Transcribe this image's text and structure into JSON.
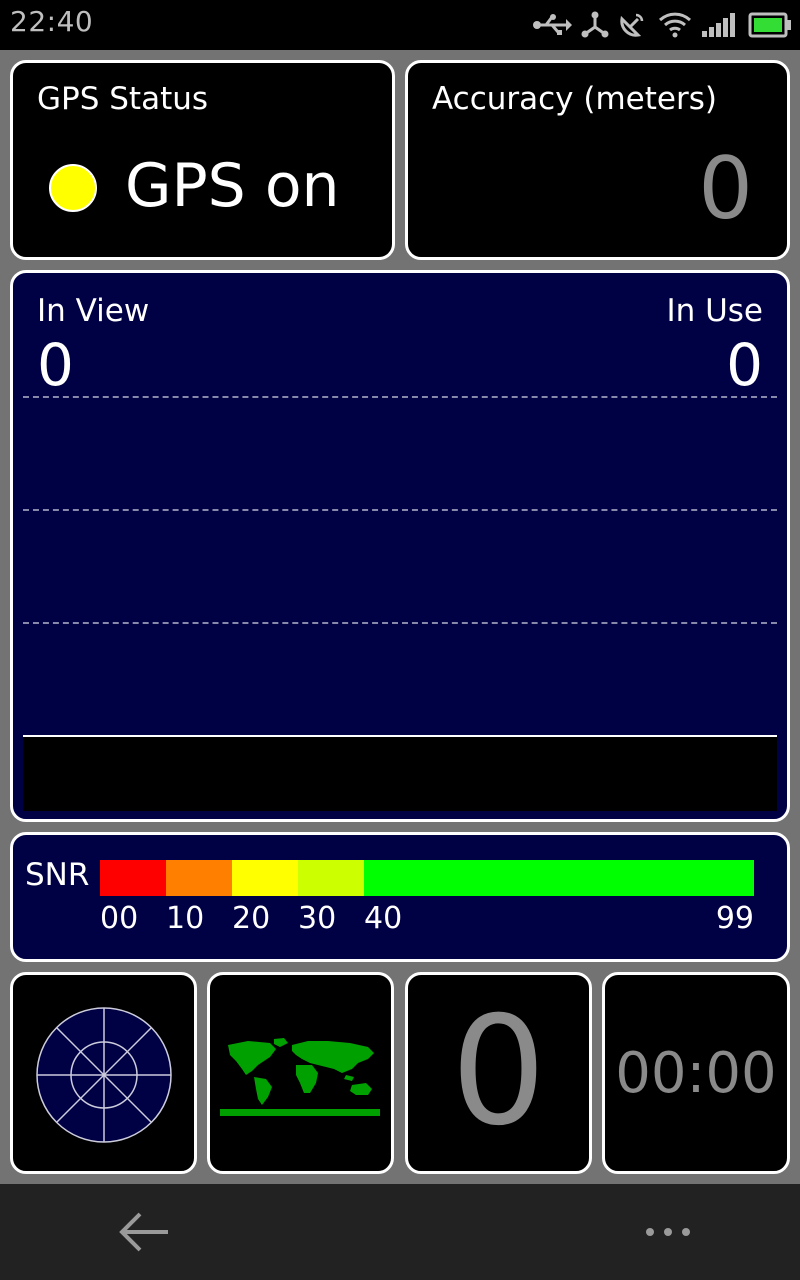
{
  "status_bar": {
    "time": "22:40",
    "icons": [
      "usb-icon",
      "share-icon",
      "gps-satellite-icon",
      "wifi-icon",
      "signal-icon",
      "battery-icon"
    ]
  },
  "gps_status": {
    "title": "GPS Status",
    "value": "GPS on",
    "indicator_color": "#ffff00"
  },
  "accuracy": {
    "title": "Accuracy (meters)",
    "value": "0"
  },
  "satellites": {
    "in_view_label": "In View",
    "in_view_value": "0",
    "in_use_label": "In Use",
    "in_use_value": "0"
  },
  "snr": {
    "label": "SNR",
    "segments": [
      {
        "from": 0,
        "to": 10,
        "color": "#ff0000"
      },
      {
        "from": 10,
        "to": 20,
        "color": "#ff8000"
      },
      {
        "from": 20,
        "to": 30,
        "color": "#ffff00"
      },
      {
        "from": 30,
        "to": 40,
        "color": "#ccff00"
      },
      {
        "from": 40,
        "to": 99,
        "color": "#00ff00"
      }
    ],
    "ticks": [
      "00",
      "10",
      "20",
      "30",
      "40",
      "99"
    ]
  },
  "tiles": {
    "count_value": "0",
    "time_value": "00:00"
  },
  "colors": {
    "panel_border": "#ffffff",
    "navy": "#000044",
    "dim_text": "#8a8a8a",
    "map_land": "#00a000"
  }
}
